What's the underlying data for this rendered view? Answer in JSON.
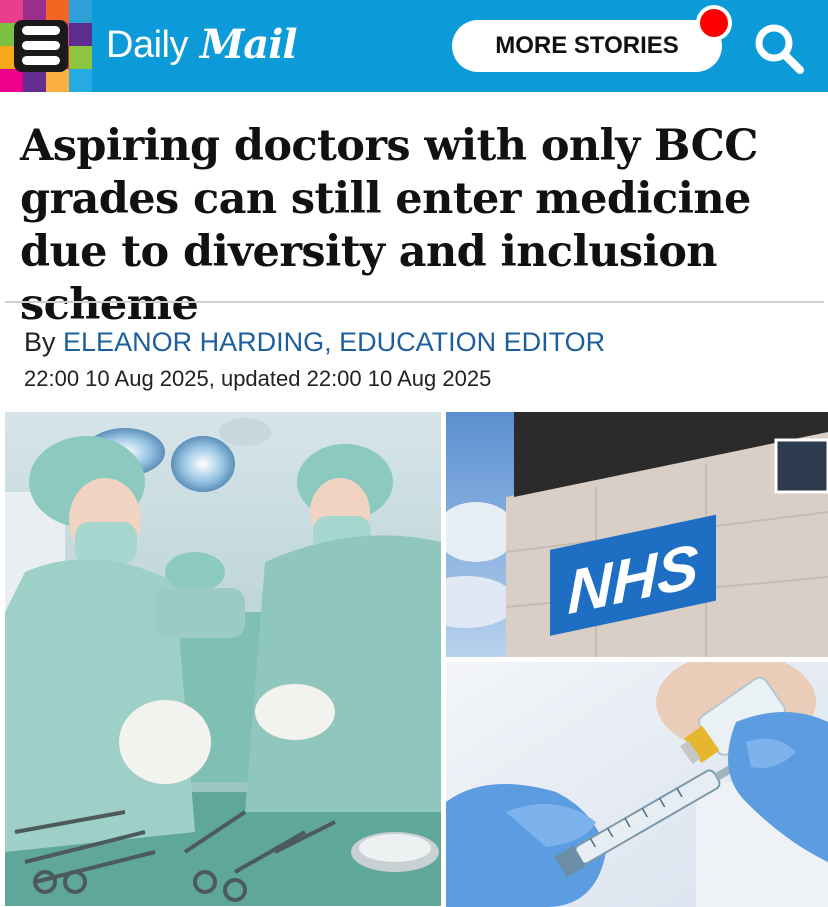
{
  "header": {
    "brand_daily": "Daily",
    "brand_mail": "Mail",
    "more_stories_label": "MORE STORIES",
    "accent_color": "#0c9ad8",
    "notification_color": "#ff0000",
    "menu_icon": "hamburger-menu-icon",
    "search_icon": "search-icon",
    "tile_colors": [
      "#e83e8c",
      "#9b2d8e",
      "#f26522",
      "#2f9fd8",
      "#7ac142",
      "#d7263d",
      "#e83e8c",
      "#5c2d91",
      "#f7a81b",
      "#00a3a1",
      "#e2231a",
      "#8dc63f",
      "#ec008c",
      "#662d91",
      "#fbb040",
      "#27aae1"
    ]
  },
  "article": {
    "headline": "Aspiring doctors with only BCC grades can still enter medicine due to diversity and inclusion scheme",
    "by_prefix": "By",
    "author": "ELEANOR HARDING, EDUCATION EDITOR",
    "dateline": "22:00 10 Aug 2025, updated 22:00 10 Aug 2025"
  },
  "images": {
    "left": "surgeons-operating-photo",
    "top_right": "nhs-sign-photo",
    "bottom_right": "vaccine-syringe-photo",
    "nhs_sign_text": "NHS"
  }
}
